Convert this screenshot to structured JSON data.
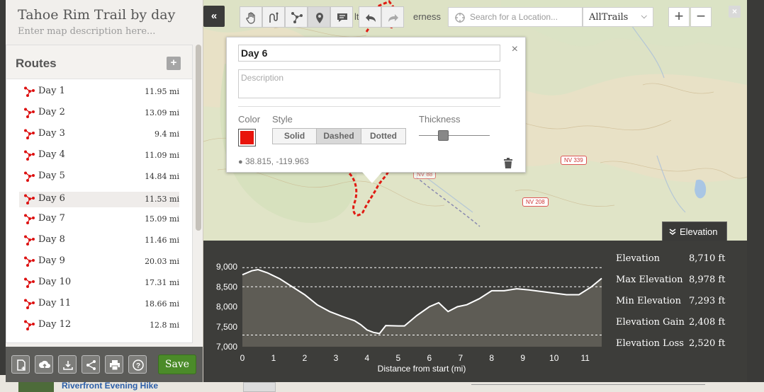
{
  "map_title": "Tahoe Rim Trail by day",
  "map_description_placeholder": "Enter map description here...",
  "routes": {
    "heading": "Routes",
    "add_label": "+",
    "items": [
      {
        "name": "Day 1",
        "distance": "11.95 mi"
      },
      {
        "name": "Day 2",
        "distance": "13.09 mi"
      },
      {
        "name": "Day 3",
        "distance": "9.4 mi"
      },
      {
        "name": "Day 4",
        "distance": "11.09 mi"
      },
      {
        "name": "Day 5",
        "distance": "14.84 mi"
      },
      {
        "name": "Day 6",
        "distance": "11.53 mi",
        "selected": true
      },
      {
        "name": "Day 7",
        "distance": "15.09 mi"
      },
      {
        "name": "Day 8",
        "distance": "11.46 mi"
      },
      {
        "name": "Day 9",
        "distance": "20.03 mi"
      },
      {
        "name": "Day 10",
        "distance": "17.31 mi"
      },
      {
        "name": "Day 11",
        "distance": "18.66 mi"
      },
      {
        "name": "Day 12",
        "distance": "12.8 mi"
      }
    ]
  },
  "footer": {
    "save_label": "Save",
    "icons": [
      "new-file-icon",
      "upload-icon",
      "download-icon",
      "share-icon",
      "print-icon",
      "help-icon"
    ]
  },
  "toolbar": {
    "collapse_label": "«",
    "tools": [
      "hand-icon",
      "freehand-icon",
      "route-icon",
      "marker-icon",
      "comment-icon",
      "undo-icon",
      "redo-icon"
    ],
    "search_placeholder": "Search for a Location...",
    "layer": "AllTrails",
    "zoom_in": "+",
    "zoom_out": "−",
    "close": "×"
  },
  "map_labels": {
    "wilderness_fragment": "erness",
    "fragment2": "lt.",
    "hwy_339": "NV 339",
    "hwy_208": "NV 208",
    "hwy_88": "NV 88"
  },
  "popup": {
    "name": "Day 6",
    "description_placeholder": "Description",
    "color_label": "Color",
    "color": "#e8140c",
    "style_label": "Style",
    "styles": [
      "Solid",
      "Dashed",
      "Dotted"
    ],
    "selected_style": "Dashed",
    "thickness_label": "Thickness",
    "thickness": 0.35,
    "coordinates": "38.815, -119.963",
    "close": "×"
  },
  "elevation_tab": "Elevation",
  "chart_data": {
    "type": "area",
    "xlabel": "Distance from start (mi)",
    "ylabel": "",
    "x_ticks": [
      "0",
      "1",
      "2",
      "3",
      "4",
      "5",
      "6",
      "7",
      "8",
      "9",
      "10",
      "11"
    ],
    "y_ticks": [
      "7,000",
      "7,500",
      "8,000",
      "8,500",
      "9,000"
    ],
    "xlim": [
      0,
      11.53
    ],
    "ylim": [
      7000,
      9000
    ],
    "reference_lines": [
      8978,
      8500,
      7293
    ],
    "x": [
      0,
      0.3,
      0.5,
      0.8,
      1.2,
      1.6,
      2.0,
      2.4,
      2.8,
      3.2,
      3.6,
      3.8,
      4.0,
      4.2,
      4.4,
      4.6,
      5.0,
      5.2,
      5.6,
      6.0,
      6.3,
      6.6,
      6.9,
      7.2,
      7.6,
      8.0,
      8.4,
      8.8,
      9.2,
      9.6,
      10.0,
      10.4,
      10.8,
      11.2,
      11.53
    ],
    "y": [
      8800,
      8900,
      8930,
      8850,
      8700,
      8500,
      8300,
      8050,
      7880,
      7760,
      7650,
      7550,
      7420,
      7360,
      7330,
      7530,
      7520,
      7520,
      7780,
      8000,
      8100,
      7880,
      8000,
      8050,
      8200,
      8400,
      8400,
      8450,
      8420,
      8380,
      8340,
      8300,
      8300,
      8500,
      8710
    ],
    "color": "#ffffff",
    "fill": "#5e5c55"
  },
  "elevation_stats": [
    {
      "label": "Elevation",
      "value": "8,710 ft"
    },
    {
      "label": "Max Elevation",
      "value": "8,978 ft"
    },
    {
      "label": "Min Elevation",
      "value": "7,293 ft"
    },
    {
      "label": "Elevation Gain",
      "value": "2,408 ft"
    },
    {
      "label": "Elevation Loss",
      "value": "2,520 ft"
    }
  ],
  "background_page": {
    "item_title": "Riverfront Evening Hike"
  }
}
